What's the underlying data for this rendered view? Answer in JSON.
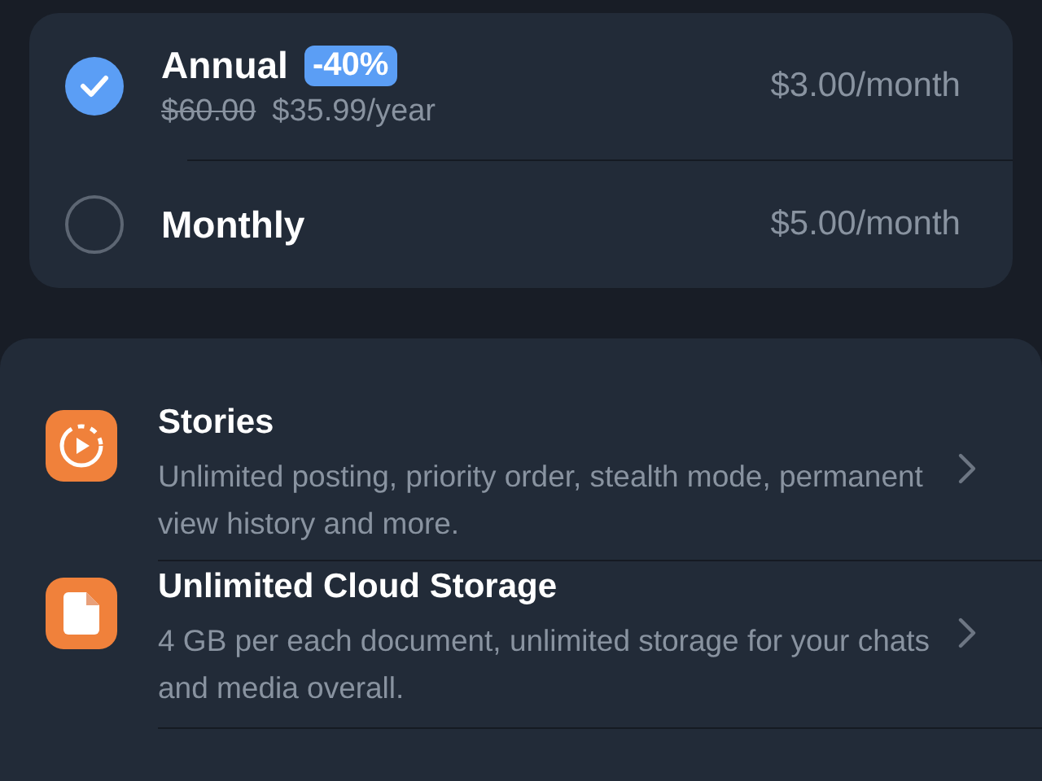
{
  "plans": [
    {
      "name": "Annual",
      "badge": "-40%",
      "old_price": "$60.00",
      "price": "$35.99/year",
      "monthly": "$3.00/month",
      "selected": true
    },
    {
      "name": "Monthly",
      "monthly": "$5.00/month",
      "selected": false
    }
  ],
  "features": [
    {
      "kind": "stories",
      "title": "Stories",
      "description": "Unlimited posting, priority order, stealth mode, permanent view history and more."
    },
    {
      "kind": "file",
      "title": "Unlimited Cloud Storage",
      "description": "4 GB per each document, unlimited storage for your chats and media overall."
    }
  ]
}
